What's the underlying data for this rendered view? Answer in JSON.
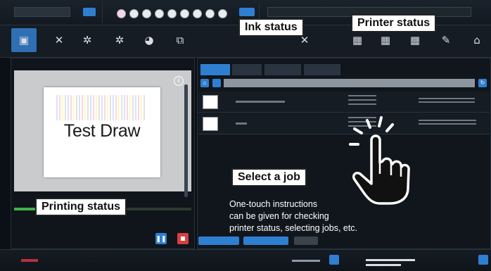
{
  "preview": {
    "sample_text": "Test Draw"
  },
  "callouts": {
    "ink_status": "Ink status",
    "printer_status": "Printer status",
    "select_job": "Select a job",
    "printing_status": "Printing status"
  },
  "description": {
    "lines": [
      "One-touch instructions",
      "can be given for checking",
      "printer status, selecting jobs, etc."
    ]
  },
  "progress": {
    "percent": 28
  },
  "colors": {
    "accent": "#2f7fd1",
    "stop": "#d84040",
    "progress": "#3fb24a",
    "background": "#0b1016"
  },
  "icons": {
    "tools": [
      "monitor-icon",
      "tools-icon",
      "gear-icon",
      "gear-icon",
      "pie-icon",
      "clipboard-icon"
    ],
    "status": [
      "ink-drop-icon",
      "printer-icon"
    ]
  }
}
